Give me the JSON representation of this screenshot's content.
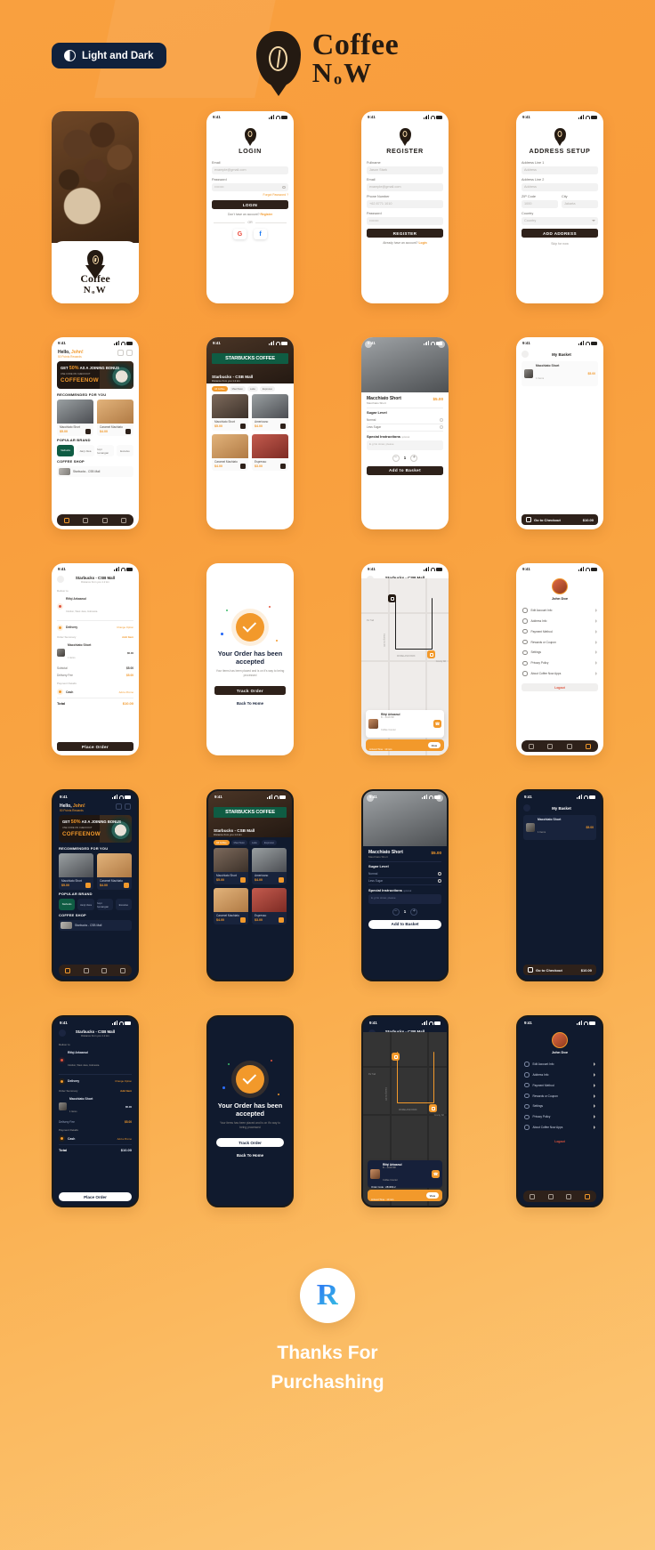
{
  "header": {
    "mode_badge": "Light and Dark",
    "brand_line1": "Coffee",
    "brand_line2": "NₒW",
    "logo_icon": "coffee-bean-pin-icon"
  },
  "status_bar": {
    "time": "9:41"
  },
  "colors": {
    "background_start": "#f9a03f",
    "background_end": "#fcc979",
    "accent": "#f2992b",
    "dark_brown": "#2e211a",
    "dark_navy": "#101a2e"
  },
  "screens": {
    "splash": {
      "brand_line1": "Coffee",
      "brand_line2": "NₒW"
    },
    "login": {
      "title": "LOGIN",
      "email_label": "Email",
      "email_placeholder": "example@gmail.com",
      "password_label": "Password",
      "password_value": "••••••••",
      "forgot": "Forgot Password ?",
      "button": "LOGIN",
      "no_account": "Don't have an account?",
      "register_link": "Register",
      "or": "OR",
      "google": "G",
      "facebook": "f"
    },
    "register": {
      "title": "REGISTER",
      "fullname_label": "Fullname",
      "fullname_placeholder": "Jason Stark",
      "email_label": "Email",
      "email_placeholder": "example@gmail.com",
      "phone_label": "Phone Number",
      "phone_placeholder": "+62 8771 1010",
      "password_label": "Password",
      "password_value": "••••••••",
      "button": "REGISTER",
      "have_account": "Already have an account?",
      "login_link": "Login"
    },
    "address_setup": {
      "title": "ADDRESS SETUP",
      "line1_label": "Address Line 1",
      "line1_placeholder": "Address",
      "line2_label": "Address Line 2",
      "line2_placeholder": "Address",
      "zip_label": "ZIP Code",
      "zip_placeholder": "1000",
      "city_label": "City",
      "city_placeholder": "Jakarta",
      "country_label": "Country",
      "country_placeholder": "Country",
      "button": "ADD ADDRESS",
      "skip": "Skip for now"
    },
    "home": {
      "greeting_hello": "Hello,",
      "greeting_name": "John!",
      "points": "50 Points Rewards",
      "promo_line1_pre": "GET",
      "promo_percent": "50%",
      "promo_line1_post": "AS A JOINING BONUS",
      "promo_small": "USE CODE ON CHECKOUT",
      "promo_brand": "COFFEENOW",
      "recommended_title": "RECOMMENDED FOR YOU",
      "products": [
        {
          "name": "Macchiato Short",
          "price": "$5.00"
        },
        {
          "name": "Caramel Machiato",
          "price": "$4.00"
        }
      ],
      "popular_title": "POPULAR BRAND",
      "brands": [
        "Starbucks",
        "Janji Jiwa",
        "Kopi Kenangan",
        "Excelso"
      ],
      "coffee_shop_title": "COFFEE SHOP",
      "shop_name": "Starbucks - CSB Mall",
      "tabs": [
        "home-icon",
        "search-icon",
        "basket-icon",
        "profile-icon"
      ]
    },
    "store": {
      "sign_text": "STARBUCKS COFFEE",
      "name": "Starbucks - CSB Mall",
      "distance": "Distance from you 1.2 km",
      "chips": [
        "All Coffee",
        "Macchiato",
        "Latte",
        "Espresso"
      ],
      "products": [
        {
          "name": "Macchiato Short",
          "price": "$5.00"
        },
        {
          "name": "Americano",
          "price": "$4.00"
        },
        {
          "name": "Caramel Machiato",
          "price": "$4.00"
        },
        {
          "name": "Espresso",
          "price": "$3.00"
        }
      ]
    },
    "detail": {
      "name": "Macchiato Short",
      "price": "$5.00",
      "desc": "Macchiato Short",
      "sugar_title": "Sugar Level",
      "sugar_options": [
        "Normal",
        "Less Sugar"
      ],
      "instructions_title": "Special Instructions",
      "instructions_optional": "optional",
      "instructions_placeholder": "E.g No straw, please",
      "qty_minus": "−",
      "qty": "1",
      "qty_plus": "+",
      "button": "Add to Basket"
    },
    "basket": {
      "title": "My Basket",
      "item_name": "Macchiato Short",
      "item_qty": "1 Items",
      "item_price": "$5.00",
      "checkout_label": "Go to Checkout",
      "checkout_total": "$10.00"
    },
    "checkout": {
      "store": "Starbucks - CSB Mall",
      "distance": "Distance from you 1.2 km",
      "deliver_to_label": "Deliver to",
      "recipient": "Rifqi Arkaanul",
      "recipient_address": "Cirebon, West Java, Indonesia",
      "delivery_label": "Delivery",
      "change_option": "Change Option",
      "order_summary_label": "Order Summary",
      "add_item": "Add Item",
      "item_name": "Macchiato Short",
      "item_qty": "1 Items",
      "item_price": "$5.00",
      "subtotal_label": "Subtotal",
      "subtotal_value": "$5.00",
      "delivery_fee_label": "Delivery Fee",
      "delivery_fee_value": "$5.00",
      "payment_label": "Payment Details",
      "payment_method": "Cash",
      "add_promo": "Add a Promo",
      "total_label": "Total",
      "total_value": "$10.00",
      "button": "Place Order"
    },
    "success": {
      "title": "Your Order has been accepted",
      "message": "Your items has been placed and is on it's way to being processed",
      "primary_button": "Track Order",
      "secondary_button": "Back To Home"
    },
    "tracking": {
      "store": "Starbucks - CSB Mall",
      "distance": "Distance from you 1.2 km",
      "map_labels": [
        "Pa Trail",
        "County Rd 20",
        "MORELAND PARK",
        "County Rd"
      ],
      "driver_name": "Rifqi Arkaanul",
      "driver_plate": "B – 2446798",
      "driver_role": "Coffee Courier",
      "order_number": "Order Code : 281990-2",
      "arrival": "Arrived Time : 10 min",
      "view_button": "View",
      "call_icon": "phone-icon"
    },
    "profile": {
      "name": "John Doe",
      "items": [
        "Edit Account Info",
        "Address Info",
        "Payment Method",
        "Rewards or Coupon",
        "Settings",
        "Privacy Policy",
        "About Coffee Now Apps"
      ],
      "logout": "Logout"
    }
  },
  "footer": {
    "logo_letter": "R",
    "line1": "Thanks For",
    "line2": "Purchashing"
  }
}
